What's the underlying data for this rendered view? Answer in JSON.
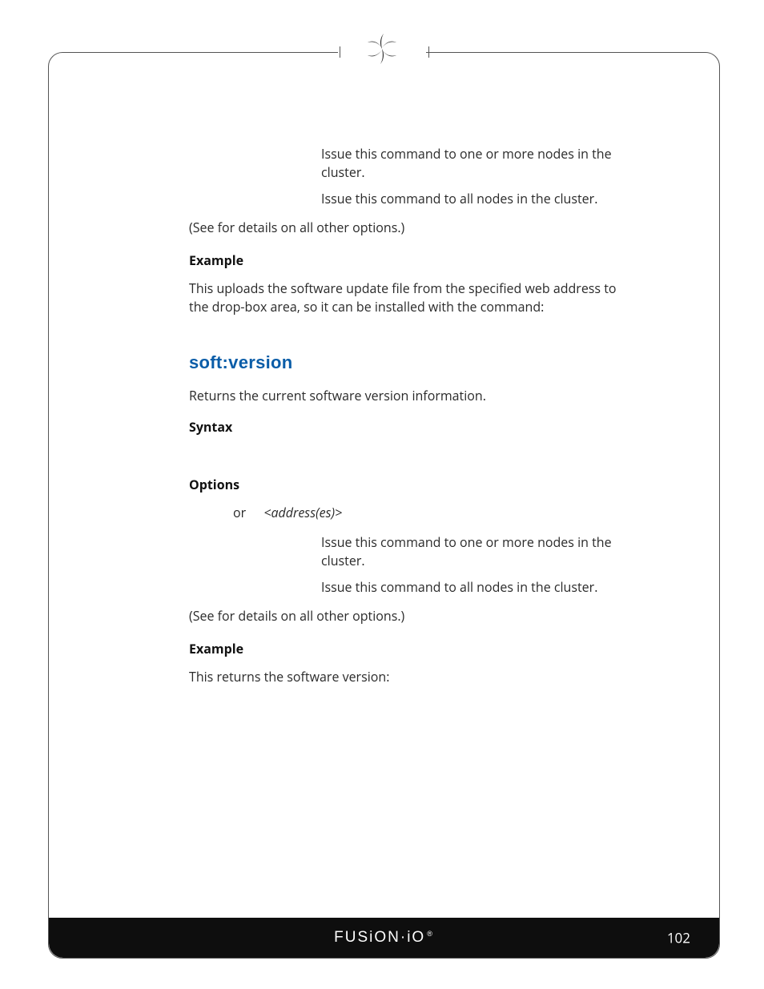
{
  "header": {
    "logo_name": "fusion-io-leaf-icon"
  },
  "section1": {
    "opt_issue_one_or_more": "Issue this command to one or more nodes in the cluster.",
    "opt_issue_all": "Issue this command to all nodes in the cluster.",
    "see_prefix": "(See ",
    "see_suffix": " for details on all other options.)",
    "example_heading": "Example",
    "example_line1_a": "This uploads the ",
    "example_line1_b": " software update file from the specified web address to the drop-box area, so it can be installed with the ",
    "example_line1_c": " command:"
  },
  "section2": {
    "title": "soft:version",
    "description": "Returns the current software version information.",
    "syntax_heading": "Syntax",
    "options_heading": "Options",
    "options_or": "or",
    "options_addresses": "<address(es)>",
    "opt_issue_one_or_more": "Issue this command to one or more nodes in the cluster.",
    "opt_issue_all": "Issue this command to all nodes in the cluster.",
    "see_prefix": "(See ",
    "see_suffix": " for details on all other options.)",
    "example_heading": "Example",
    "example_text": "This returns the software version:"
  },
  "footer": {
    "brand": "FUSiON·iO",
    "page_number": "102"
  }
}
